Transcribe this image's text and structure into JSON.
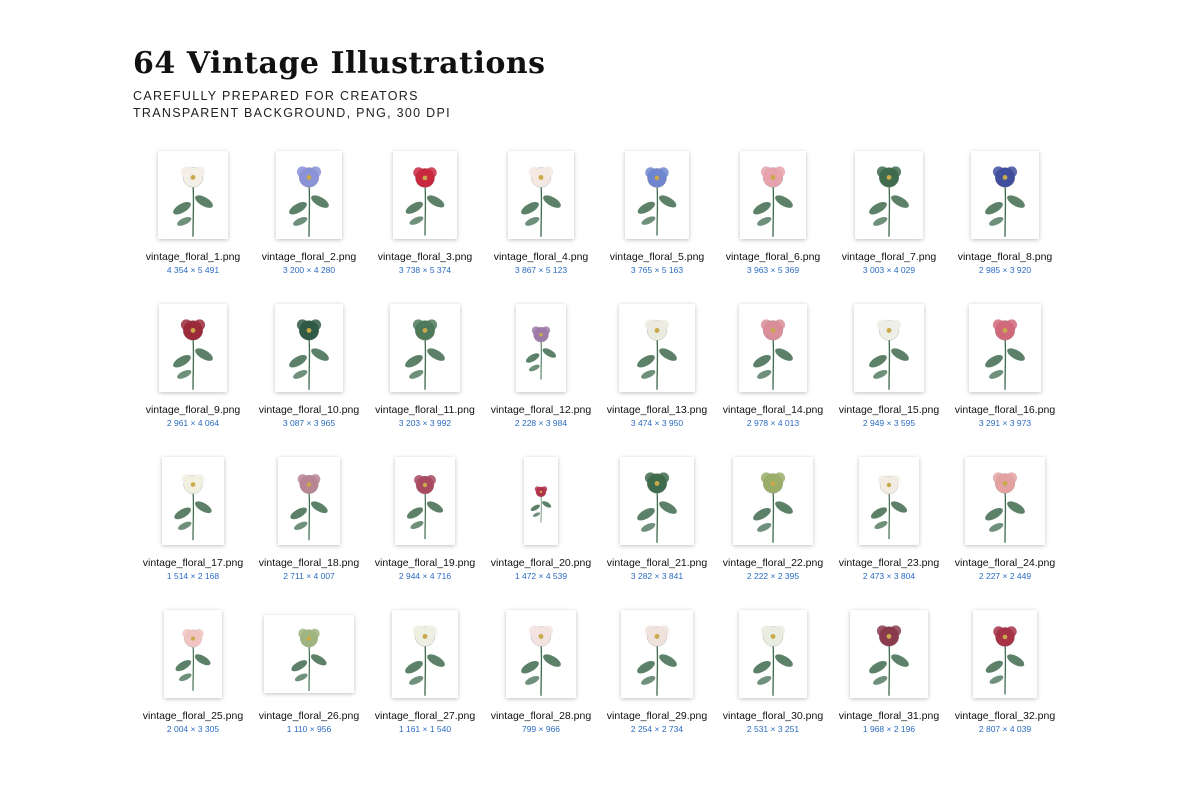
{
  "header": {
    "title": "64 Vintage Illustrations",
    "subtitle_line1": "CAREFULLY PREPARED FOR CREATORS",
    "subtitle_line2": "TRANSPARENT BACKGROUND, PNG, 300 DPI"
  },
  "colors": {
    "link_blue": "#2a6bc2",
    "leaf_green": "#3f6b4e",
    "petal_pink": "#e7a3ad",
    "petal_red": "#c8293f",
    "petal_blue": "#7d8fd6"
  },
  "files": [
    {
      "name": "vintage_floral_1.png",
      "dims": "4 354 × 5 491",
      "flower": "white-peony",
      "color": "#f3efe6"
    },
    {
      "name": "vintage_floral_2.png",
      "dims": "3 200 × 4 280",
      "flower": "blue-bells",
      "color": "#8a92d8"
    },
    {
      "name": "vintage_floral_3.png",
      "dims": "3 738 × 5 374",
      "flower": "red-camellia",
      "color": "#c8293f"
    },
    {
      "name": "vintage_floral_4.png",
      "dims": "3 867 × 5 123",
      "flower": "white-blossom",
      "color": "#f4e9e2"
    },
    {
      "name": "vintage_floral_5.png",
      "dims": "3 765 × 5 163",
      "flower": "blue-spikes",
      "color": "#6f86cf"
    },
    {
      "name": "vintage_floral_6.png",
      "dims": "3 963 × 5 369",
      "flower": "pink-peony",
      "color": "#e7a3ad"
    },
    {
      "name": "vintage_floral_7.png",
      "dims": "3 003 × 4 029",
      "flower": "green-leaves",
      "color": "#3f6b4e"
    },
    {
      "name": "vintage_floral_8.png",
      "dims": "2 985 × 3 920",
      "flower": "blue-cluster",
      "color": "#3f4f9e"
    },
    {
      "name": "vintage_floral_9.png",
      "dims": "2 961 × 4 064",
      "flower": "red-berries",
      "color": "#9b2a3a"
    },
    {
      "name": "vintage_floral_10.png",
      "dims": "3 087 × 3 965",
      "flower": "dark-leaves",
      "color": "#2f5a45"
    },
    {
      "name": "vintage_floral_11.png",
      "dims": "3 203 × 3 992",
      "flower": "green-sprig",
      "color": "#4e7a5a"
    },
    {
      "name": "vintage_floral_12.png",
      "dims": "2 228 × 3 984",
      "flower": "lilac",
      "color": "#9d7aa8"
    },
    {
      "name": "vintage_floral_13.png",
      "dims": "3 474 × 3 950",
      "flower": "white-magnolia",
      "color": "#ecebe0"
    },
    {
      "name": "vintage_floral_14.png",
      "dims": "2 978 × 4 013",
      "flower": "pink-sprig",
      "color": "#d98e9a"
    },
    {
      "name": "vintage_floral_15.png",
      "dims": "2 949 × 3 595",
      "flower": "white-blossom",
      "color": "#efefe8"
    },
    {
      "name": "vintage_floral_16.png",
      "dims": "3 291 × 3 973",
      "flower": "pink-camellia",
      "color": "#d06a7b"
    },
    {
      "name": "vintage_floral_17.png",
      "dims": "1 514 × 2 168",
      "flower": "white-daffodil",
      "color": "#f1f0e0"
    },
    {
      "name": "vintage_floral_18.png",
      "dims": "2 711 × 4 007",
      "flower": "rhododendron",
      "color": "#b78593"
    },
    {
      "name": "vintage_floral_19.png",
      "dims": "2 944 × 4 716",
      "flower": "magenta-magnolia",
      "color": "#a84a60"
    },
    {
      "name": "vintage_floral_20.png",
      "dims": "1 472 × 4 539",
      "flower": "red-spike",
      "color": "#b2344a"
    },
    {
      "name": "vintage_floral_21.png",
      "dims": "3 282 × 3 841",
      "flower": "broad-leaves",
      "color": "#3f6b4e"
    },
    {
      "name": "vintage_floral_22.png",
      "dims": "2 222 × 2 395",
      "flower": "hosta",
      "color": "#9aae6a"
    },
    {
      "name": "vintage_floral_23.png",
      "dims": "2 473 × 3 804",
      "flower": "white-lilies",
      "color": "#f2ece2"
    },
    {
      "name": "vintage_floral_24.png",
      "dims": "2 227 × 2 449",
      "flower": "pink-lilies",
      "color": "#e3a1a0"
    },
    {
      "name": "vintage_floral_25.png",
      "dims": "2 004 × 3 305",
      "flower": "pink-amaryllis",
      "color": "#f0c4c0"
    },
    {
      "name": "vintage_floral_26.png",
      "dims": "1 110 × 956",
      "flower": "single-leaf",
      "color": "#9fb47f"
    },
    {
      "name": "vintage_floral_27.png",
      "dims": "1 161 × 1 540",
      "flower": "white-agapanthus",
      "color": "#eeeee2"
    },
    {
      "name": "vintage_floral_28.png",
      "dims": "799 × 966",
      "flower": "white-lily",
      "color": "#f3e3e0"
    },
    {
      "name": "vintage_floral_29.png",
      "dims": "2 254 × 2 734",
      "flower": "white-amaryllis",
      "color": "#efe2dc"
    },
    {
      "name": "vintage_floral_30.png",
      "dims": "2 531 × 3 251",
      "flower": "white-amaryllis-leaves",
      "color": "#e9ece0"
    },
    {
      "name": "vintage_floral_31.png",
      "dims": "1 968 × 2 196",
      "flower": "dark-roses",
      "color": "#8a3b4e"
    },
    {
      "name": "vintage_floral_32.png",
      "dims": "2 807 × 4 039",
      "flower": "red-sprig",
      "color": "#a63346"
    }
  ]
}
